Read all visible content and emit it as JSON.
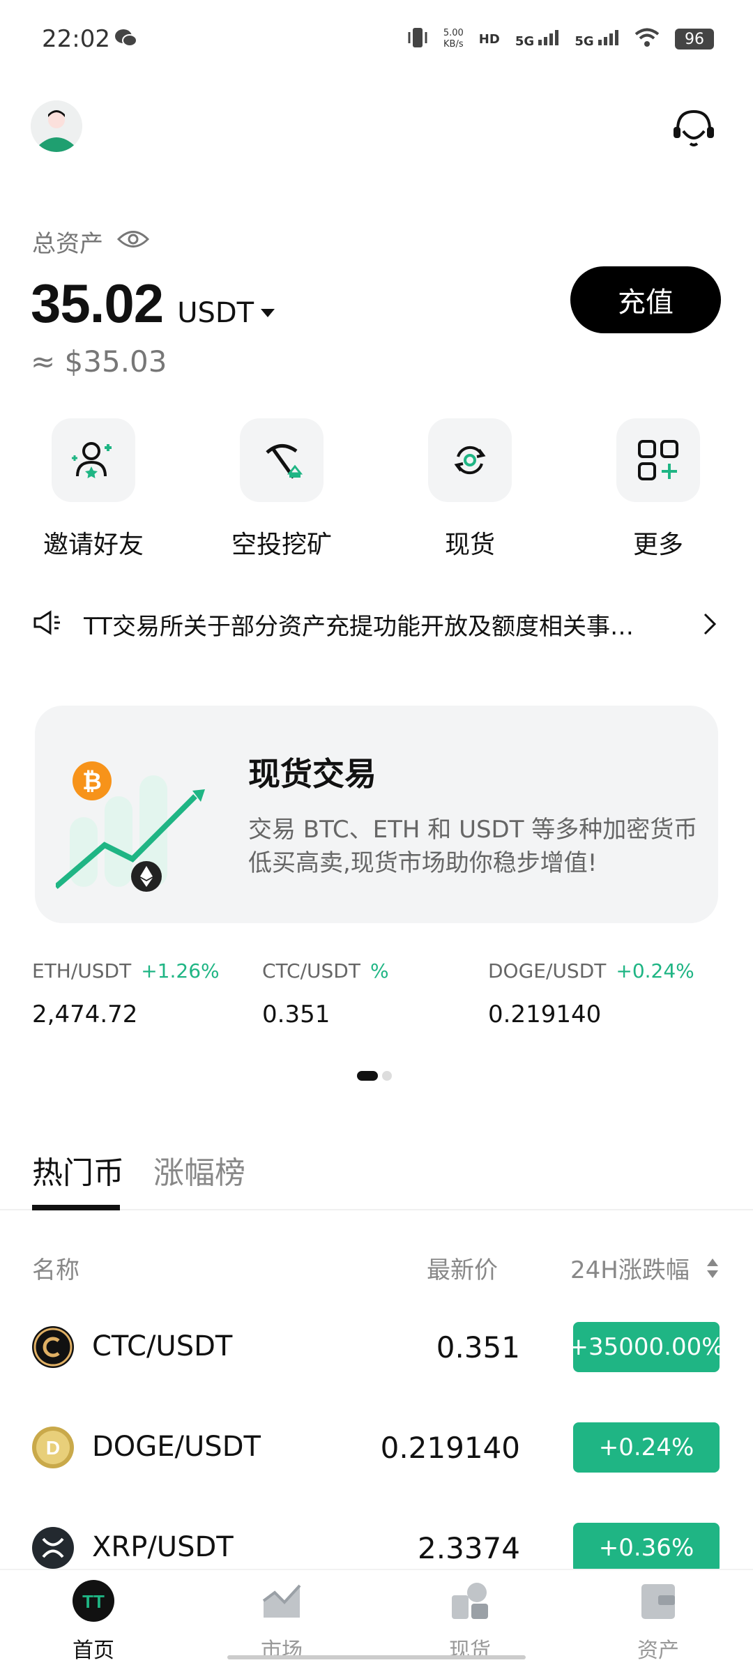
{
  "status_bar": {
    "time": "22:02",
    "speed_value": "5.00",
    "speed_unit": "KB/s",
    "hd": "HD",
    "net1": "5G",
    "net2": "5G",
    "battery": "96"
  },
  "assets": {
    "label": "总资产",
    "value": "35.02",
    "unit": "USDT",
    "usd_equiv": "≈ $35.03",
    "deposit_label": "充值"
  },
  "quick_actions": [
    {
      "label": "邀请好友",
      "icon": "invite-friend-icon"
    },
    {
      "label": "空投挖矿",
      "icon": "pickaxe-icon"
    },
    {
      "label": "现货",
      "icon": "spot-exchange-icon"
    },
    {
      "label": "更多",
      "icon": "more-apps-icon"
    }
  ],
  "announcement": {
    "text": "TT交易所关于部分资产充提功能开放及额度相关事…"
  },
  "banner": {
    "title": "现货交易",
    "desc": "交易 BTC、ETH 和 USDT 等多种加密货币低买高卖,现货市场助你稳步增值!"
  },
  "tickers": [
    {
      "pair": "ETH/USDT",
      "change": "+1.26%",
      "price": "2,474.72"
    },
    {
      "pair": "CTC/USDT",
      "change": "%",
      "price": "0.351"
    },
    {
      "pair": "DOGE/USDT",
      "change": "+0.24%",
      "price": "0.219140"
    }
  ],
  "tabs": {
    "hot": "热门币",
    "gainers": "涨幅榜"
  },
  "list_header": {
    "name": "名称",
    "price": "最新价",
    "change": "24H涨跌幅"
  },
  "coins": [
    {
      "pair": "CTC/USDT",
      "price": "0.351",
      "change": "+35000.00%"
    },
    {
      "pair": "DOGE/USDT",
      "price": "0.219140",
      "change": "+0.24%"
    },
    {
      "pair": "XRP/USDT",
      "price": "2.3374",
      "change": "+0.36%"
    }
  ],
  "bottom_nav": [
    {
      "label": "首页",
      "icon": "home-tt-icon"
    },
    {
      "label": "市场",
      "icon": "market-chart-icon"
    },
    {
      "label": "现货",
      "icon": "spot-icon"
    },
    {
      "label": "资产",
      "icon": "wallet-icon"
    }
  ],
  "colors": {
    "accent_green": "#1fb584",
    "btc_orange": "#f7931a",
    "primary_black": "#000000"
  }
}
